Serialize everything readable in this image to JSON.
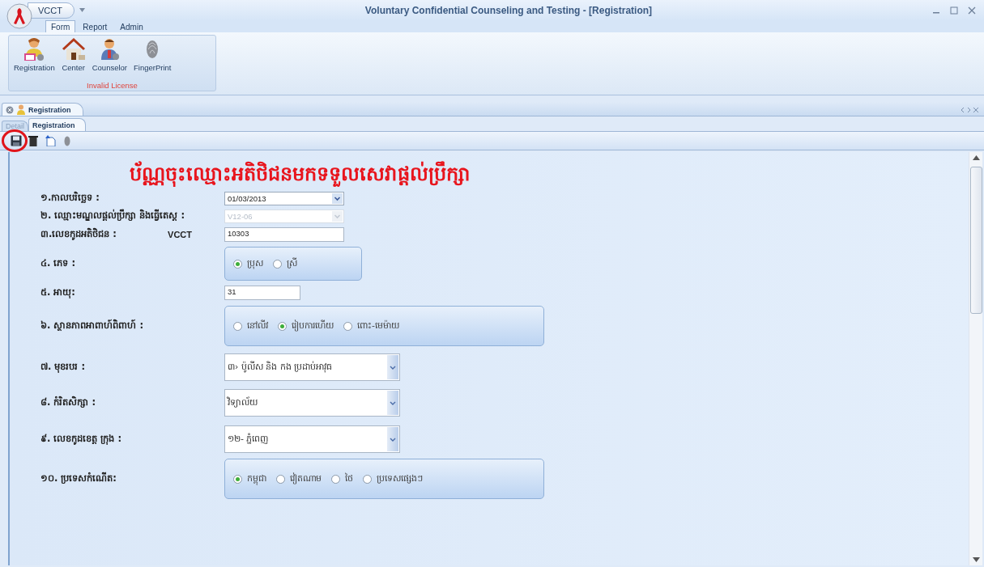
{
  "window": {
    "app_button": "VCCT",
    "title": "Voluntary Confidential Counseling and Testing - [Registration]"
  },
  "ribbon_tabs": [
    {
      "label": "Form",
      "selected": true
    },
    {
      "label": "Report",
      "selected": false
    },
    {
      "label": "Admin",
      "selected": false
    }
  ],
  "ribbon_group": {
    "caption": "Invalid License",
    "buttons": [
      {
        "kind": "registration",
        "label": "Registration"
      },
      {
        "kind": "center",
        "label": "Center"
      },
      {
        "kind": "counselor",
        "label": "Counselor"
      },
      {
        "kind": "fingerprint",
        "label": "FingerPrint"
      }
    ]
  },
  "document_tab": {
    "label": "Registration"
  },
  "sub_tabs": [
    {
      "label": "Detail",
      "selected": false
    },
    {
      "label": "Registration",
      "selected": true
    }
  ],
  "toolbar": [
    {
      "kind": "save",
      "highlighted": true
    },
    {
      "kind": "delete",
      "highlighted": false
    },
    {
      "kind": "new",
      "highlighted": false
    },
    {
      "kind": "fingerprint",
      "highlighted": false
    }
  ],
  "form": {
    "title": "ប័ណ្ណចុះឈ្មោះអតិថិជនមកទទួលសេវាផ្តល់ប្រឹក្សា",
    "rows": [
      {
        "label": "១.កាលបរិច្ឆេទ :",
        "kind": "dropdown",
        "value": "01/03/2013",
        "disabled": false
      },
      {
        "label": "២. ឈ្មោះមណ្ឌលផ្តល់ប្រឹក្សា និងធ្វើតេស្ត :",
        "kind": "dropdown",
        "value": "V12-06",
        "disabled": true
      },
      {
        "label": "៣.លេខកូដអតិថិជន :",
        "prefix": "VCCT",
        "kind": "text",
        "value": "10303"
      },
      {
        "label": "៤. ភេទ :",
        "kind": "radio",
        "options": [
          {
            "label": "ប្រុស",
            "selected": true
          },
          {
            "label": "ស្រី",
            "selected": false
          }
        ]
      },
      {
        "label": "៥. អាយុ:",
        "kind": "short-text",
        "value": "31"
      },
      {
        "label": "៦. ស្ថានភាពអាពាហ៍ពិពាហ៍ :",
        "kind": "radio",
        "options": [
          {
            "label": "នៅលីវ",
            "selected": false
          },
          {
            "label": "រៀបការហើយ",
            "selected": true
          },
          {
            "label": "ពោះ-មេម៉ាយ",
            "selected": false
          }
        ]
      },
      {
        "label": "៧. មុខរបរ :",
        "kind": "combo",
        "value": "៣› ប៉ូលីស និង កង ប្រដាប់អាវុធ"
      },
      {
        "label": "៨. កំរិតសិក្សា :",
        "kind": "combo",
        "value": "វិទ្យាល័យ"
      },
      {
        "label": "៩. លេខកូដខេត្ត ក្រុង :",
        "kind": "combo",
        "value": "១២- ភ្នំពេញ"
      },
      {
        "label": "១០. ប្រទេសកំណើត:",
        "kind": "radio",
        "options": [
          {
            "label": "កម្ពុជា",
            "selected": true
          },
          {
            "label": "វៀតណាម",
            "selected": false
          },
          {
            "label": "ថៃ",
            "selected": false
          },
          {
            "label": "ប្រទេសផ្សេងៗ",
            "selected": false
          }
        ]
      }
    ]
  }
}
